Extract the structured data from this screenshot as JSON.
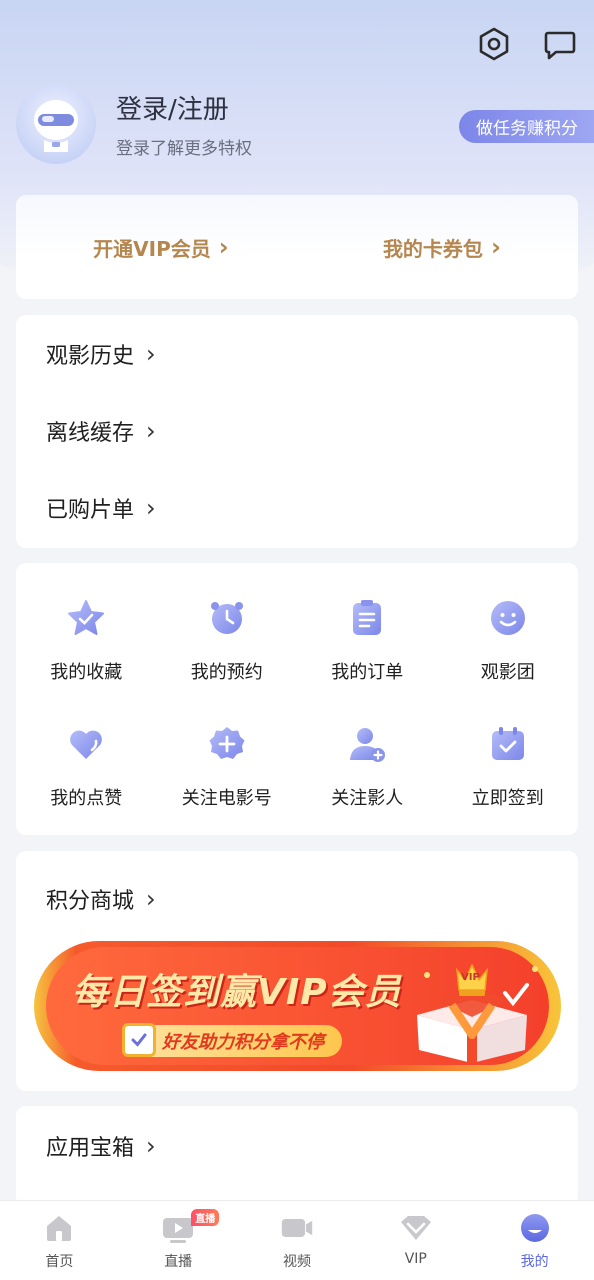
{
  "header": {
    "login_title": "登录/注册",
    "login_subtitle": "登录了解更多特权",
    "task_button": "做任务赚积分",
    "icons": [
      "settings-icon",
      "message-icon"
    ]
  },
  "vip_bar": {
    "open_vip": "开通VIP会员",
    "coupon_wallet": "我的卡券包"
  },
  "main_list": {
    "items": [
      {
        "label": "观影历史"
      },
      {
        "label": "离线缓存"
      },
      {
        "label": "已购片单"
      }
    ]
  },
  "grid": {
    "items": [
      {
        "label": "我的收藏",
        "icon": "star-icon"
      },
      {
        "label": "我的预约",
        "icon": "alarm-clock-icon"
      },
      {
        "label": "我的订单",
        "icon": "clipboard-icon"
      },
      {
        "label": "观影团",
        "icon": "smiley-icon"
      },
      {
        "label": "我的点赞",
        "icon": "heart-icon"
      },
      {
        "label": "关注电影号",
        "icon": "add-badge-icon"
      },
      {
        "label": "关注影人",
        "icon": "add-person-icon"
      },
      {
        "label": "立即签到",
        "icon": "calendar-check-icon"
      }
    ]
  },
  "points_mall": {
    "label": "积分商城",
    "banner_title": "每日签到赢VIP会员",
    "banner_subtitle": "好友助力积分拿不停",
    "banner_badge": "VIP"
  },
  "tools": {
    "label": "应用宝箱"
  },
  "tabbar": {
    "tabs": [
      {
        "label": "首页",
        "icon": "home-icon"
      },
      {
        "label": "直播",
        "icon": "live-tv-icon",
        "badge": "直播"
      },
      {
        "label": "视频",
        "icon": "video-camera-icon"
      },
      {
        "label": "VIP",
        "icon": "vip-diamond-icon"
      },
      {
        "label": "我的",
        "icon": "profile-icon",
        "active": true
      }
    ],
    "active_color": "#5b68e0"
  },
  "colors": {
    "accent": "#7c86e8",
    "vip_gold": "#b5874f",
    "icon_gradient": [
      "#a9b2f4",
      "#7d88ea"
    ]
  }
}
